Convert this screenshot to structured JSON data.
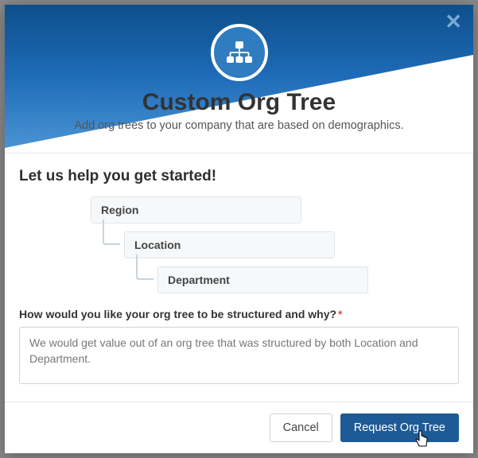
{
  "modal": {
    "title": "Custom Org Tree",
    "subtitle": "Add org trees to your company that are based on demographics."
  },
  "body": {
    "started_heading": "Let us help you get started!",
    "tree": {
      "level1": "Region",
      "level2": "Location",
      "level3": "Department"
    },
    "question_label": "How would you like your org tree to be structured and why?",
    "required_mark": "*",
    "textarea_value": "We would get value out of an org tree that was structured by both Location and Department. "
  },
  "footer": {
    "cancel_label": "Cancel",
    "submit_label": "Request Org Tree"
  }
}
